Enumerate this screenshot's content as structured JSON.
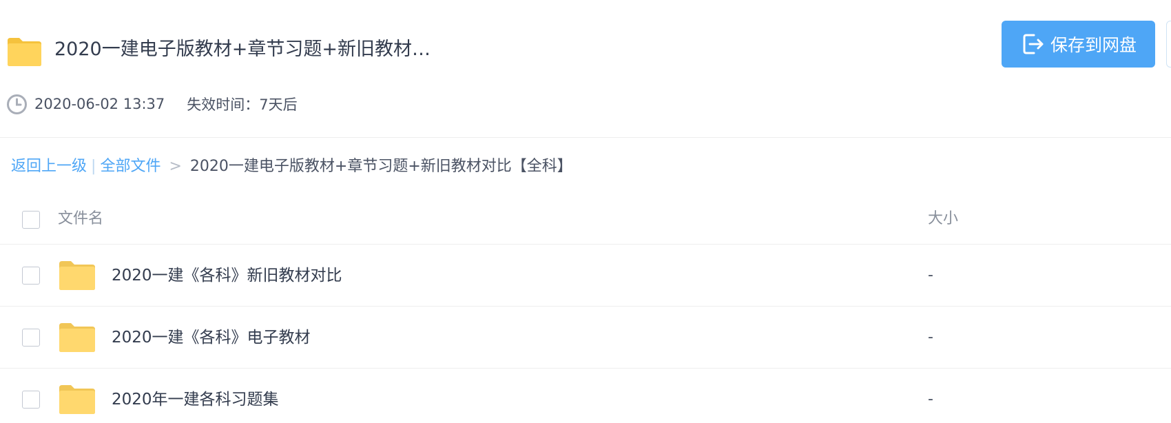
{
  "header": {
    "title": "2020一建电子版教材+章节习题+新旧教材…",
    "save_button_label": "保存到网盘",
    "share_time": "2020-06-02 13:37",
    "expire_text": "失效时间：7天后"
  },
  "breadcrumb": {
    "back": "返回上一级",
    "separator": "|",
    "all_files": "全部文件",
    "arrow": ">",
    "current": "2020一建电子版教材+章节习题+新旧教材对比【全科】"
  },
  "table": {
    "columns": {
      "name": "文件名",
      "size": "大小"
    },
    "rows": [
      {
        "name": "2020一建《各科》新旧教材对比",
        "size": "-"
      },
      {
        "name": "2020一建《各科》电子教材",
        "size": "-"
      },
      {
        "name": "2020年一建各科习题集",
        "size": "-"
      }
    ]
  },
  "icons": {
    "folder": "folder-icon",
    "clock": "clock-icon",
    "save": "save-to-drive-icon"
  },
  "colors": {
    "accent": "#4ea6f6",
    "folder": "#ffd45c",
    "text": "#333c4e"
  }
}
